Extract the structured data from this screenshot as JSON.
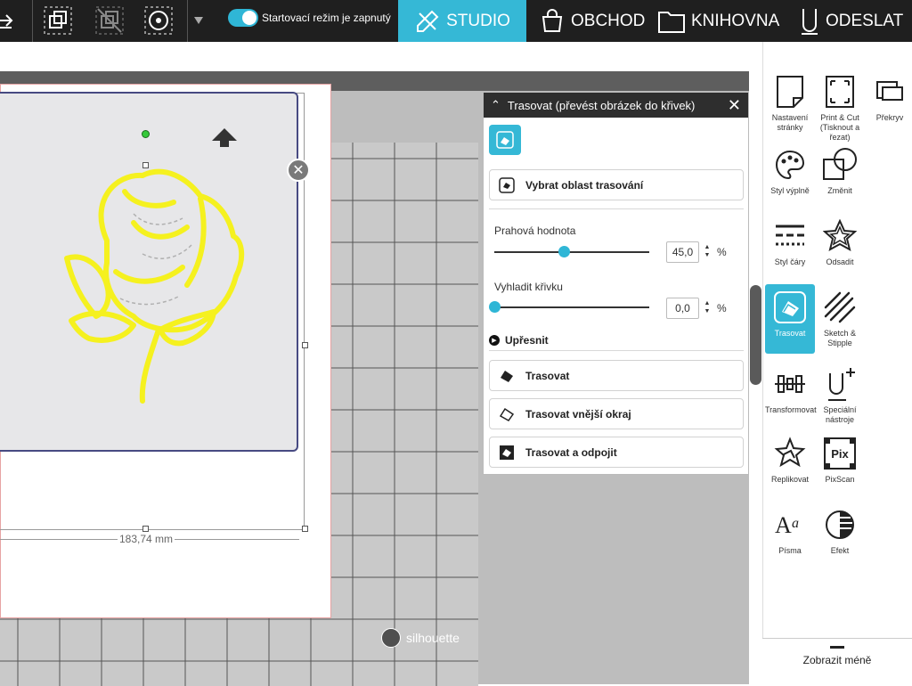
{
  "topbar": {
    "startup_label": "Startovací režim je zapnutý",
    "tabs": [
      {
        "label": "STUDIO",
        "icon": "pencil-ruler-icon"
      },
      {
        "label": "OBCHOD",
        "icon": "shopping-bag-icon"
      },
      {
        "label": "KNIHOVNA",
        "icon": "folder-icon"
      },
      {
        "label": "ODESLAT",
        "icon": "cutter-icon"
      }
    ],
    "active_tab": "STUDIO"
  },
  "canvas": {
    "dimension": "183,74 mm",
    "logo": "silhouette"
  },
  "trace_panel": {
    "title": "Trasovat (převést obrázek do křivek)",
    "select_area": "Vybrat oblast trasování",
    "threshold_label": "Prahová hodnota",
    "threshold_value": "45,0",
    "threshold_percent": 45,
    "smooth_label": "Vyhladit křivku",
    "smooth_value": "0,0",
    "smooth_percent": 0,
    "unit": "%",
    "refine_label": "Upřesnit",
    "actions": [
      "Trasovat",
      "Trasovat vnější okraj",
      "Trasovat a odpojit"
    ]
  },
  "sidebar": {
    "items": [
      {
        "label": "Nastavení stránky",
        "icon": "page-setup-icon"
      },
      {
        "label": "Print & Cut (Tisknout a řezat)",
        "icon": "print-cut-icon"
      },
      {
        "label": "Překryv",
        "icon": "overlap-icon"
      },
      {
        "label": "Styl výplně",
        "icon": "palette-icon"
      },
      {
        "label": "Změnit",
        "icon": "modify-icon"
      },
      {
        "label": "Styl čáry",
        "icon": "line-style-icon"
      },
      {
        "label": "Odsadit",
        "icon": "offset-star-icon"
      },
      {
        "label": "Trasovat",
        "icon": "trace-icon"
      },
      {
        "label": "Sketch & Stipple",
        "icon": "sketch-icon"
      },
      {
        "label": "Transformovat",
        "icon": "transform-icon"
      },
      {
        "label": "Speciální nástroje",
        "icon": "special-tools-icon"
      },
      {
        "label": "Replikovat",
        "icon": "replicate-icon"
      },
      {
        "label": "PixScan",
        "icon": "pixscan-icon"
      },
      {
        "label": "Písma",
        "icon": "fonts-icon"
      },
      {
        "label": "Efekt",
        "icon": "effect-icon"
      }
    ],
    "active": "Trasovat",
    "show_less": "Zobrazit méně"
  },
  "colors": {
    "accent": "#35b8d6",
    "trace_yellow": "#f5f11f",
    "topbar": "#1f1f1f"
  }
}
